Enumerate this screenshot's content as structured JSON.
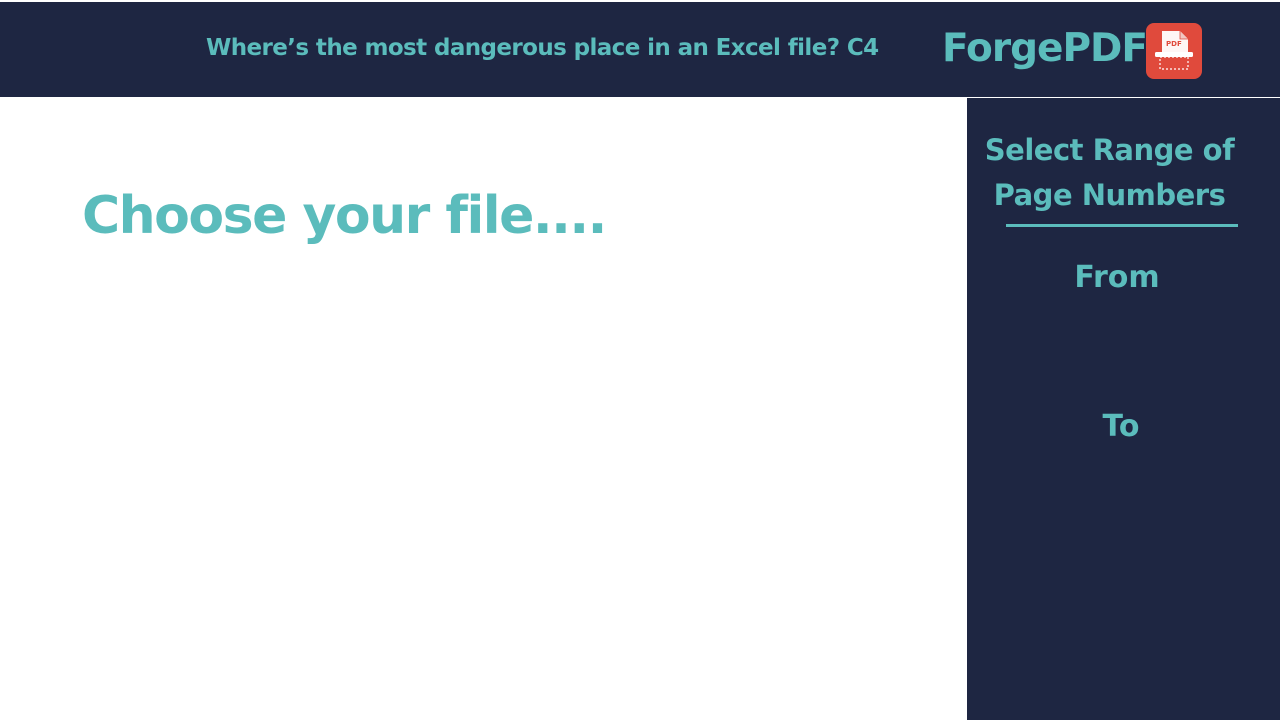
{
  "header": {
    "question": "Where’s the most dangerous place in an Excel file? C4",
    "brand": "ForgePDF",
    "logo_icon": "pdf-scanner-icon",
    "logo_text": "PDF"
  },
  "main": {
    "heading": "Choose your file...."
  },
  "sidebar": {
    "title_line1": "Select Range of",
    "title_line2": "Page Numbers",
    "from_label": "From",
    "to_label": "To"
  },
  "colors": {
    "navy": "#1e2642",
    "teal": "#5bbcbc",
    "logo_red": "#e04a3c"
  }
}
